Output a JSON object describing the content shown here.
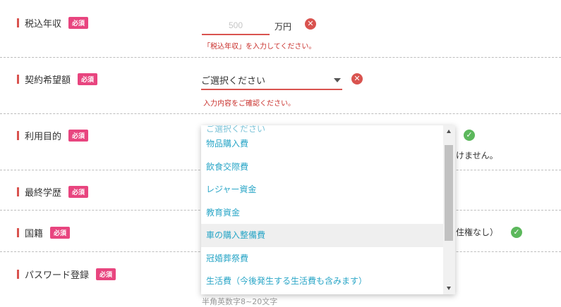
{
  "form": {
    "required_badge": "必須",
    "income": {
      "label": "税込年収",
      "placeholder": "500",
      "unit": "万円",
      "error": "「税込年収」を入力してください。"
    },
    "contract": {
      "label": "契約希望額",
      "selected": "ご選択ください",
      "error": "入力内容をご確認ください。"
    },
    "purpose": {
      "label": "利用目的",
      "obscured_text": "けません。"
    },
    "education": {
      "label": "最終学歴"
    },
    "nationality": {
      "label": "国籍",
      "obscured_text": "住権なし）"
    },
    "password": {
      "label": "パスワード登録",
      "hint": "半角英数字8~20文字"
    }
  },
  "dropdown": {
    "partial_item": "ご選択ください",
    "items": [
      "物品購入費",
      "飲食交際費",
      "レジャー資金",
      "教育資金",
      "車の購入整備費",
      "冠婚葬祭費",
      "生活費（今後発生する生活費も含みます）"
    ],
    "highlighted_index": 4
  },
  "colors": {
    "error": "#d9534f",
    "success": "#5cb85c",
    "badge": "#e8457f",
    "option_text": "#2aa6c7"
  }
}
